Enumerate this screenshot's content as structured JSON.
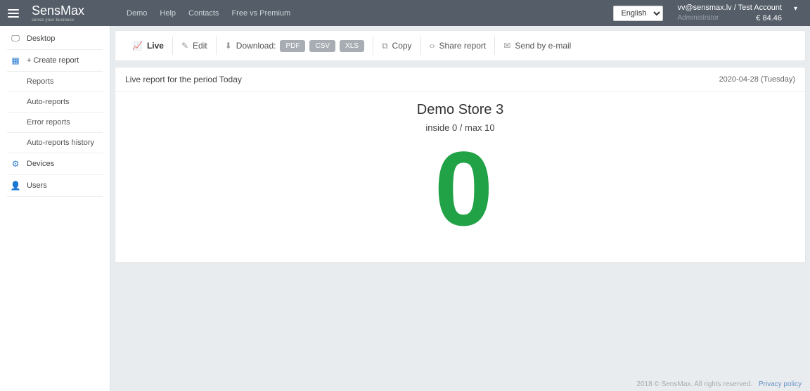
{
  "header": {
    "logo_main": "SensMax",
    "logo_sub": "sense your business",
    "nav": [
      "Demo",
      "Help",
      "Contacts",
      "Free vs Premium"
    ],
    "language": "English",
    "user_line": "vv@sensmax.lv / Test Account",
    "user_role": "Administrator",
    "balance": "€ 84.46"
  },
  "sidebar": {
    "desktop": "Desktop",
    "create_report": "+ Create report",
    "reports": "Reports",
    "auto_reports": "Auto-reports",
    "error_reports": "Error reports",
    "auto_reports_history": "Auto-reports history",
    "devices": "Devices",
    "users": "Users"
  },
  "toolbar": {
    "live": "Live",
    "edit": "Edit",
    "download": "Download:",
    "pdf": "PDF",
    "csv": "CSV",
    "xls": "XLS",
    "copy": "Copy",
    "share": "Share report",
    "email": "Send by e-mail"
  },
  "report": {
    "title": "Live report for the period Today",
    "date": "2020-04-28 (Tuesday)",
    "store_name": "Demo Store 3",
    "capacity_text": "inside 0 / max 10",
    "count": "0"
  },
  "footer": {
    "copyright": "2018 © SensMax. All rights reserved.",
    "privacy": "Privacy policy"
  }
}
